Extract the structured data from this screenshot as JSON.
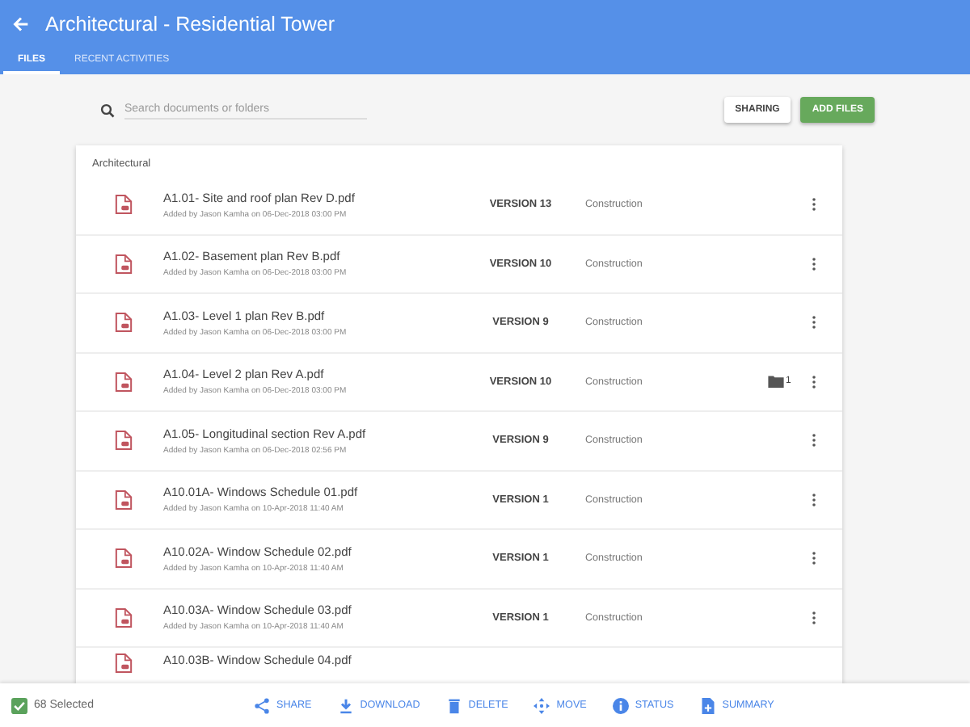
{
  "header": {
    "title": "Architectural - Residential Tower"
  },
  "tabs": [
    {
      "label": "FILES",
      "selected": true
    },
    {
      "label": "RECENT ACTIVITIES",
      "selected": false
    }
  ],
  "search": {
    "placeholder": "Search documents or folders"
  },
  "buttons": {
    "sharing": "SHARING",
    "add_files": "ADD FILES"
  },
  "folder": {
    "title": "Architectural",
    "files": [
      {
        "name": "A1.01- Site and roof plan Rev D.pdf",
        "added": "Added by Jason Kamha on 06-Dec-2018 03:00 PM",
        "version": "VERSION 13",
        "status": "Construction"
      },
      {
        "name": "A1.02- Basement plan Rev B.pdf",
        "added": "Added by Jason Kamha on 06-Dec-2018 03:00 PM",
        "version": "VERSION 10",
        "status": "Construction"
      },
      {
        "name": "A1.03- Level 1 plan Rev B.pdf",
        "added": "Added by Jason Kamha on 06-Dec-2018 03:00 PM",
        "version": "VERSION 9",
        "status": "Construction"
      },
      {
        "name": "A1.04- Level 2 plan Rev A.pdf",
        "added": "Added by Jason Kamha on 06-Dec-2018 03:00 PM",
        "version": "VERSION 10",
        "status": "Construction",
        "attachments": "1"
      },
      {
        "name": "A1.05- Longitudinal section Rev A.pdf",
        "added": "Added by Jason Kamha on 06-Dec-2018 02:56 PM",
        "version": "VERSION 9",
        "status": "Construction"
      },
      {
        "name": "A10.01A- Windows Schedule 01.pdf",
        "added": "Added by Jason Kamha on 10-Apr-2018 11:40 AM",
        "version": "VERSION 1",
        "status": "Construction"
      },
      {
        "name": "A10.02A- Window Schedule 02.pdf",
        "added": "Added by Jason Kamha on 10-Apr-2018 11:40 AM",
        "version": "VERSION 1",
        "status": "Construction"
      },
      {
        "name": "A10.03A- Window Schedule 03.pdf",
        "added": "Added by Jason Kamha on 10-Apr-2018 11:40 AM",
        "version": "VERSION 1",
        "status": "Construction"
      },
      {
        "name": "A10.03B- Window Schedule 04.pdf"
      }
    ]
  },
  "selection": {
    "checked": true,
    "label": "68 Selected"
  },
  "actions": [
    {
      "kind": "share",
      "label": "SHARE"
    },
    {
      "kind": "download",
      "label": "DOWNLOAD"
    },
    {
      "kind": "delete",
      "label": "DELETE"
    },
    {
      "kind": "move",
      "label": "MOVE"
    },
    {
      "kind": "status",
      "label": "STATUS"
    },
    {
      "kind": "summary",
      "label": "SUMMARY"
    }
  ]
}
